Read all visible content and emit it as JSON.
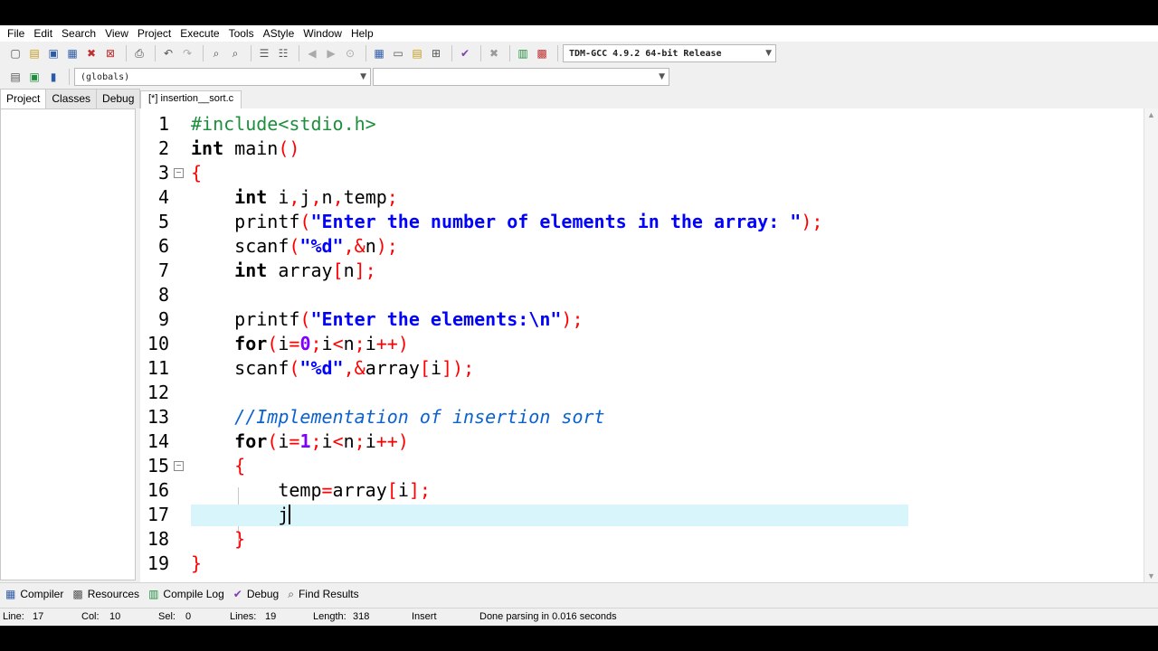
{
  "menu": [
    "File",
    "Edit",
    "Search",
    "View",
    "Project",
    "Execute",
    "Tools",
    "AStyle",
    "Window",
    "Help"
  ],
  "toolbar": {
    "compiler_select": "TDM-GCC 4.9.2 64-bit Release",
    "scope_select": "(globals)",
    "member_select": ""
  },
  "left_panel": {
    "tabs": [
      "Project",
      "Classes",
      "Debug"
    ]
  },
  "editor": {
    "tab_label": "[*] insertion__sort.c",
    "lines": [
      {
        "n": "1"
      },
      {
        "n": "2"
      },
      {
        "n": "3"
      },
      {
        "n": "4"
      },
      {
        "n": "5"
      },
      {
        "n": "6"
      },
      {
        "n": "7"
      },
      {
        "n": "8"
      },
      {
        "n": "9"
      },
      {
        "n": "10"
      },
      {
        "n": "11"
      },
      {
        "n": "12"
      },
      {
        "n": "13"
      },
      {
        "n": "14"
      },
      {
        "n": "15"
      },
      {
        "n": "16"
      },
      {
        "n": "17"
      },
      {
        "n": "18"
      },
      {
        "n": "19"
      }
    ],
    "tokens": {
      "l1": "#include<stdio.h>",
      "l2a": "int",
      "l2b": " main",
      "l2c": "()",
      "l3": "{",
      "l4a": "    ",
      "l4b": "int",
      "l4c": " i",
      "l4d": ",",
      "l4e": "j",
      "l4f": ",",
      "l4g": "n",
      "l4h": ",",
      "l4i": "temp",
      "l4j": ";",
      "l5a": "    printf",
      "l5b": "(",
      "l5c": "\"Enter the number of elements in the array: \"",
      "l5d": ");",
      "l6a": "    scanf",
      "l6b": "(",
      "l6c": "\"%d\"",
      "l6d": ",&",
      "l6e": "n",
      "l6f": ");",
      "l7a": "    ",
      "l7b": "int",
      "l7c": " array",
      "l7d": "[",
      "l7e": "n",
      "l7f": "];",
      "l9a": "    printf",
      "l9b": "(",
      "l9c": "\"Enter the elements:\\n\"",
      "l9d": ");",
      "l10a": "    ",
      "l10b": "for",
      "l10c": "(",
      "l10d": "i",
      "l10e": "=",
      "l10f": "0",
      "l10g": ";",
      "l10h": "i",
      "l10i": "<",
      "l10j": "n",
      "l10k": ";",
      "l10l": "i",
      "l10m": "++)",
      "l11a": "    scanf",
      "l11b": "(",
      "l11c": "\"%d\"",
      "l11d": ",&",
      "l11e": "array",
      "l11f": "[",
      "l11g": "i",
      "l11h": "]);",
      "l13a": "    ",
      "l13b": "//Implementation of insertion sort",
      "l14a": "    ",
      "l14b": "for",
      "l14c": "(",
      "l14d": "i",
      "l14e": "=",
      "l14f": "1",
      "l14g": ";",
      "l14h": "i",
      "l14i": "<",
      "l14j": "n",
      "l14k": ";",
      "l14l": "i",
      "l14m": "++)",
      "l15a": "    ",
      "l15b": "{",
      "l16a": "        temp",
      "l16b": "=",
      "l16c": "array",
      "l16d": "[",
      "l16e": "i",
      "l16f": "];",
      "l17a": "        j",
      "l18a": "    ",
      "l18b": "}",
      "l19": "}"
    }
  },
  "bottom_tabs": [
    "Compiler",
    "Resources",
    "Compile Log",
    "Debug",
    "Find Results"
  ],
  "status": {
    "line_label": "Line:",
    "line_val": "17",
    "col_label": "Col:",
    "col_val": "10",
    "sel_label": "Sel:",
    "sel_val": "0",
    "lines_label": "Lines:",
    "lines_val": "19",
    "length_label": "Length:",
    "length_val": "318",
    "mode": "Insert",
    "message": "Done parsing in 0.016 seconds"
  },
  "colors": {
    "keyword": "#000000",
    "preprocessor": "#1d8f3c",
    "string": "#0000ff",
    "number": "#8000ff",
    "symbol": "#ff0000",
    "comment": "#0a62d0",
    "current_line": "#d7f5fa"
  },
  "icons": [
    "new-file-icon",
    "open-icon",
    "save-icon",
    "save-all-icon",
    "close-icon",
    "close-all-icon",
    "print-icon",
    "undo-icon",
    "redo-icon",
    "find-icon",
    "replace-icon",
    "indent-icon",
    "unindent-icon",
    "back-icon",
    "forward-icon",
    "goto-icon",
    "new-project-icon",
    "class-icon",
    "add-icon",
    "remove-icon",
    "compile-icon",
    "stop-icon",
    "chart-icon",
    "profile-icon"
  ]
}
